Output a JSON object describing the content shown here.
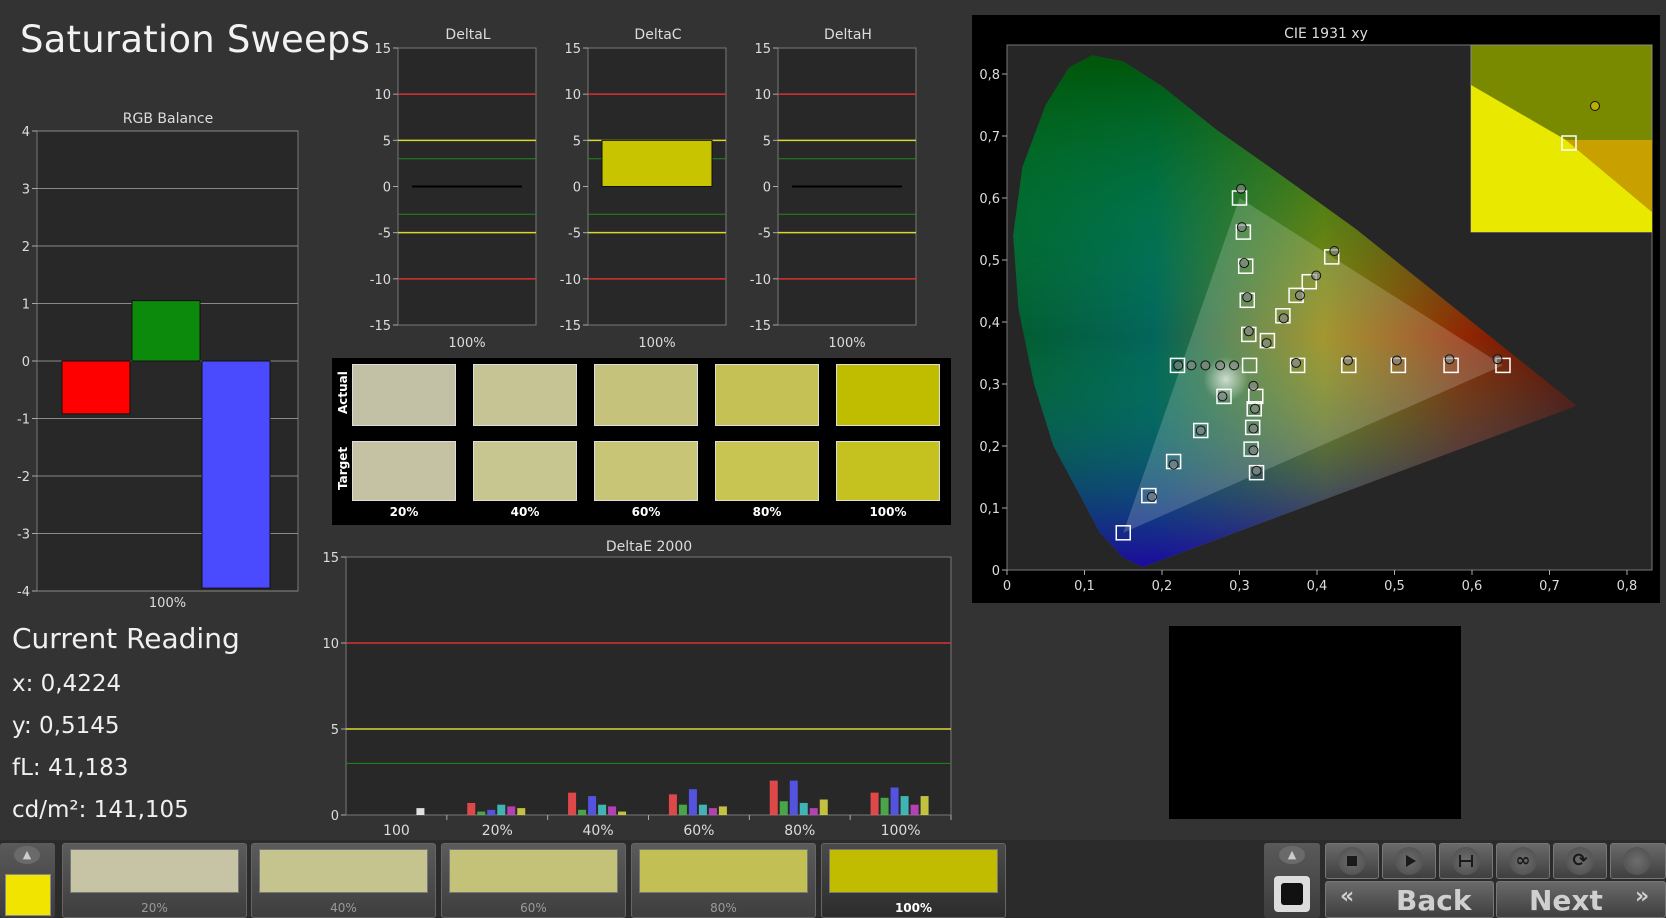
{
  "page": {
    "title": "Saturation Sweeps"
  },
  "rgb_balance": {
    "title": "RGB Balance",
    "xlabel": "100%",
    "y_ticks": [
      "4",
      "3",
      "2",
      "1",
      "0",
      "-1",
      "-2",
      "-3",
      "-4"
    ],
    "bars": [
      {
        "name": "Red",
        "value": -0.92,
        "color": "#ff0000"
      },
      {
        "name": "Green",
        "value": 1.05,
        "color": "#0c8a0c"
      },
      {
        "name": "Blue",
        "value": -3.95,
        "color": "#4a4aff"
      }
    ]
  },
  "delta_charts": [
    {
      "title": "DeltaL",
      "xlabel": "100%",
      "value": 0.0,
      "y_ticks": [
        "15",
        "10",
        "5",
        "0",
        "-5",
        "-10",
        "-15"
      ]
    },
    {
      "title": "DeltaC",
      "xlabel": "100%",
      "value": 5.0,
      "y_ticks": [
        "15",
        "10",
        "5",
        "0",
        "-5",
        "-10",
        "-15"
      ]
    },
    {
      "title": "DeltaH",
      "xlabel": "100%",
      "value": 0.0,
      "y_ticks": [
        "15",
        "10",
        "5",
        "0",
        "-5",
        "-10",
        "-15"
      ]
    }
  ],
  "swatches": {
    "row_labels": [
      "Actual",
      "Target"
    ],
    "columns": [
      "20%",
      "40%",
      "60%",
      "80%",
      "100%"
    ],
    "actual_colors": [
      "#c2c0a5",
      "#c6c494",
      "#c5c27c",
      "#c6c154",
      "#c0bc00"
    ],
    "target_colors": [
      "#c4c2a2",
      "#c8c690",
      "#c8c577",
      "#c9c553",
      "#c5c11f"
    ]
  },
  "deltae": {
    "title": "DeltaE 2000",
    "y_ticks": [
      "15",
      "10",
      "5",
      "0"
    ],
    "categories": [
      "100",
      "20%",
      "40%",
      "60%",
      "80%",
      "100%"
    ],
    "series_colors": [
      "#ff4d4d",
      "#4dbb4d",
      "#5a5aff",
      "#44cccc",
      "#cc44cc",
      "#dddd44"
    ]
  },
  "chart_data": [
    {
      "type": "bar",
      "title": "RGB Balance",
      "xlabel": "100%",
      "ylim": [
        -4,
        4
      ],
      "categories": [
        "Red",
        "Green",
        "Blue"
      ],
      "values": [
        -0.92,
        1.05,
        -3.95
      ]
    },
    {
      "type": "bar",
      "title": "DeltaL",
      "xlabel": "100%",
      "ylim": [
        -15,
        15
      ],
      "values": [
        0.0
      ]
    },
    {
      "type": "bar",
      "title": "DeltaC",
      "xlabel": "100%",
      "ylim": [
        -15,
        15
      ],
      "values": [
        5.0
      ]
    },
    {
      "type": "bar",
      "title": "DeltaH",
      "xlabel": "100%",
      "ylim": [
        -15,
        15
      ],
      "values": [
        0.0
      ]
    },
    {
      "type": "bar",
      "title": "DeltaE 2000",
      "ylim": [
        0,
        15
      ],
      "categories": [
        "100",
        "20%",
        "40%",
        "60%",
        "80%",
        "100%"
      ],
      "series": [
        {
          "values": [
            0,
            0.7,
            1.3,
            1.2,
            2.0,
            1.3
          ]
        },
        {
          "values": [
            0,
            0.2,
            0.3,
            0.6,
            0.8,
            1.0
          ]
        },
        {
          "values": [
            0,
            0.3,
            1.1,
            1.5,
            2.0,
            1.6
          ]
        },
        {
          "values": [
            0,
            0.6,
            0.6,
            0.6,
            0.7,
            1.1
          ]
        },
        {
          "values": [
            0,
            0.5,
            0.5,
            0.4,
            0.4,
            0.6
          ]
        },
        {
          "values": [
            0.4,
            0.4,
            0.2,
            0.5,
            0.9,
            1.1
          ]
        }
      ]
    },
    {
      "type": "scatter",
      "title": "CIE 1931 xy",
      "xlim": [
        0,
        0.8
      ],
      "ylim": [
        0,
        0.8
      ],
      "x_ticks": [
        "0",
        "0,1",
        "0,2",
        "0,3",
        "0,4",
        "0,5",
        "0,6",
        "0,7",
        "0,8"
      ],
      "y_ticks": [
        "0",
        "0,1",
        "0,2",
        "0,3",
        "0,4",
        "0,5",
        "0,6",
        "0,7",
        "0,8"
      ],
      "series": [
        {
          "name": "targets",
          "points": [
            [
              0.64,
              0.33
            ],
            [
              0.573,
              0.33
            ],
            [
              0.505,
              0.33
            ],
            [
              0.441,
              0.33
            ],
            [
              0.375,
              0.33
            ],
            [
              0.3,
              0.6
            ],
            [
              0.305,
              0.545
            ],
            [
              0.308,
              0.49
            ],
            [
              0.31,
              0.435
            ],
            [
              0.312,
              0.38
            ],
            [
              0.22,
              0.33
            ],
            [
              0.313,
              0.33
            ],
            [
              0.15,
              0.06
            ],
            [
              0.183,
              0.12
            ],
            [
              0.215,
              0.175
            ],
            [
              0.25,
              0.225
            ],
            [
              0.28,
              0.28
            ],
            [
              0.419,
              0.505
            ],
            [
              0.39,
              0.465
            ],
            [
              0.373,
              0.443
            ],
            [
              0.356,
              0.41
            ],
            [
              0.336,
              0.37
            ],
            [
              0.321,
              0.28
            ],
            [
              0.319,
              0.26
            ],
            [
              0.317,
              0.23
            ],
            [
              0.315,
              0.195
            ],
            [
              0.322,
              0.157
            ]
          ]
        },
        {
          "name": "readings",
          "points": [
            [
              0.633,
              0.34
            ],
            [
              0.571,
              0.34
            ],
            [
              0.503,
              0.338
            ],
            [
              0.44,
              0.338
            ],
            [
              0.373,
              0.334
            ],
            [
              0.302,
              0.615
            ],
            [
              0.303,
              0.553
            ],
            [
              0.306,
              0.495
            ],
            [
              0.31,
              0.44
            ],
            [
              0.312,
              0.385
            ],
            [
              0.221,
              0.33
            ],
            [
              0.238,
              0.33
            ],
            [
              0.256,
              0.33
            ],
            [
              0.275,
              0.33
            ],
            [
              0.293,
              0.33
            ],
            [
              0.187,
              0.118
            ],
            [
              0.215,
              0.17
            ],
            [
              0.25,
              0.225
            ],
            [
              0.278,
              0.28
            ],
            [
              0.4224,
              0.5145
            ],
            [
              0.399,
              0.475
            ],
            [
              0.378,
              0.443
            ],
            [
              0.357,
              0.406
            ],
            [
              0.335,
              0.366
            ],
            [
              0.318,
              0.297
            ],
            [
              0.32,
              0.26
            ],
            [
              0.318,
              0.228
            ],
            [
              0.318,
              0.193
            ],
            [
              0.322,
              0.16
            ]
          ]
        }
      ]
    }
  ],
  "cie": {
    "title": "CIE 1931 xy"
  },
  "reading": {
    "heading": "Current Reading",
    "x": "x: 0,4224",
    "y": "y: 0,5145",
    "fl": "fL: 41,183",
    "cdm2": "cd/m²: 141,105"
  },
  "bottom": {
    "current_color": "#f0e400",
    "tiles": [
      {
        "label": "20%",
        "color": "#c6c4a5"
      },
      {
        "label": "40%",
        "color": "#c6c48e"
      },
      {
        "label": "60%",
        "color": "#c4c278"
      },
      {
        "label": "80%",
        "color": "#c2bf55"
      },
      {
        "label": "100%",
        "color": "#c2bc00"
      }
    ],
    "back_label": "Back",
    "next_label": "Next"
  }
}
